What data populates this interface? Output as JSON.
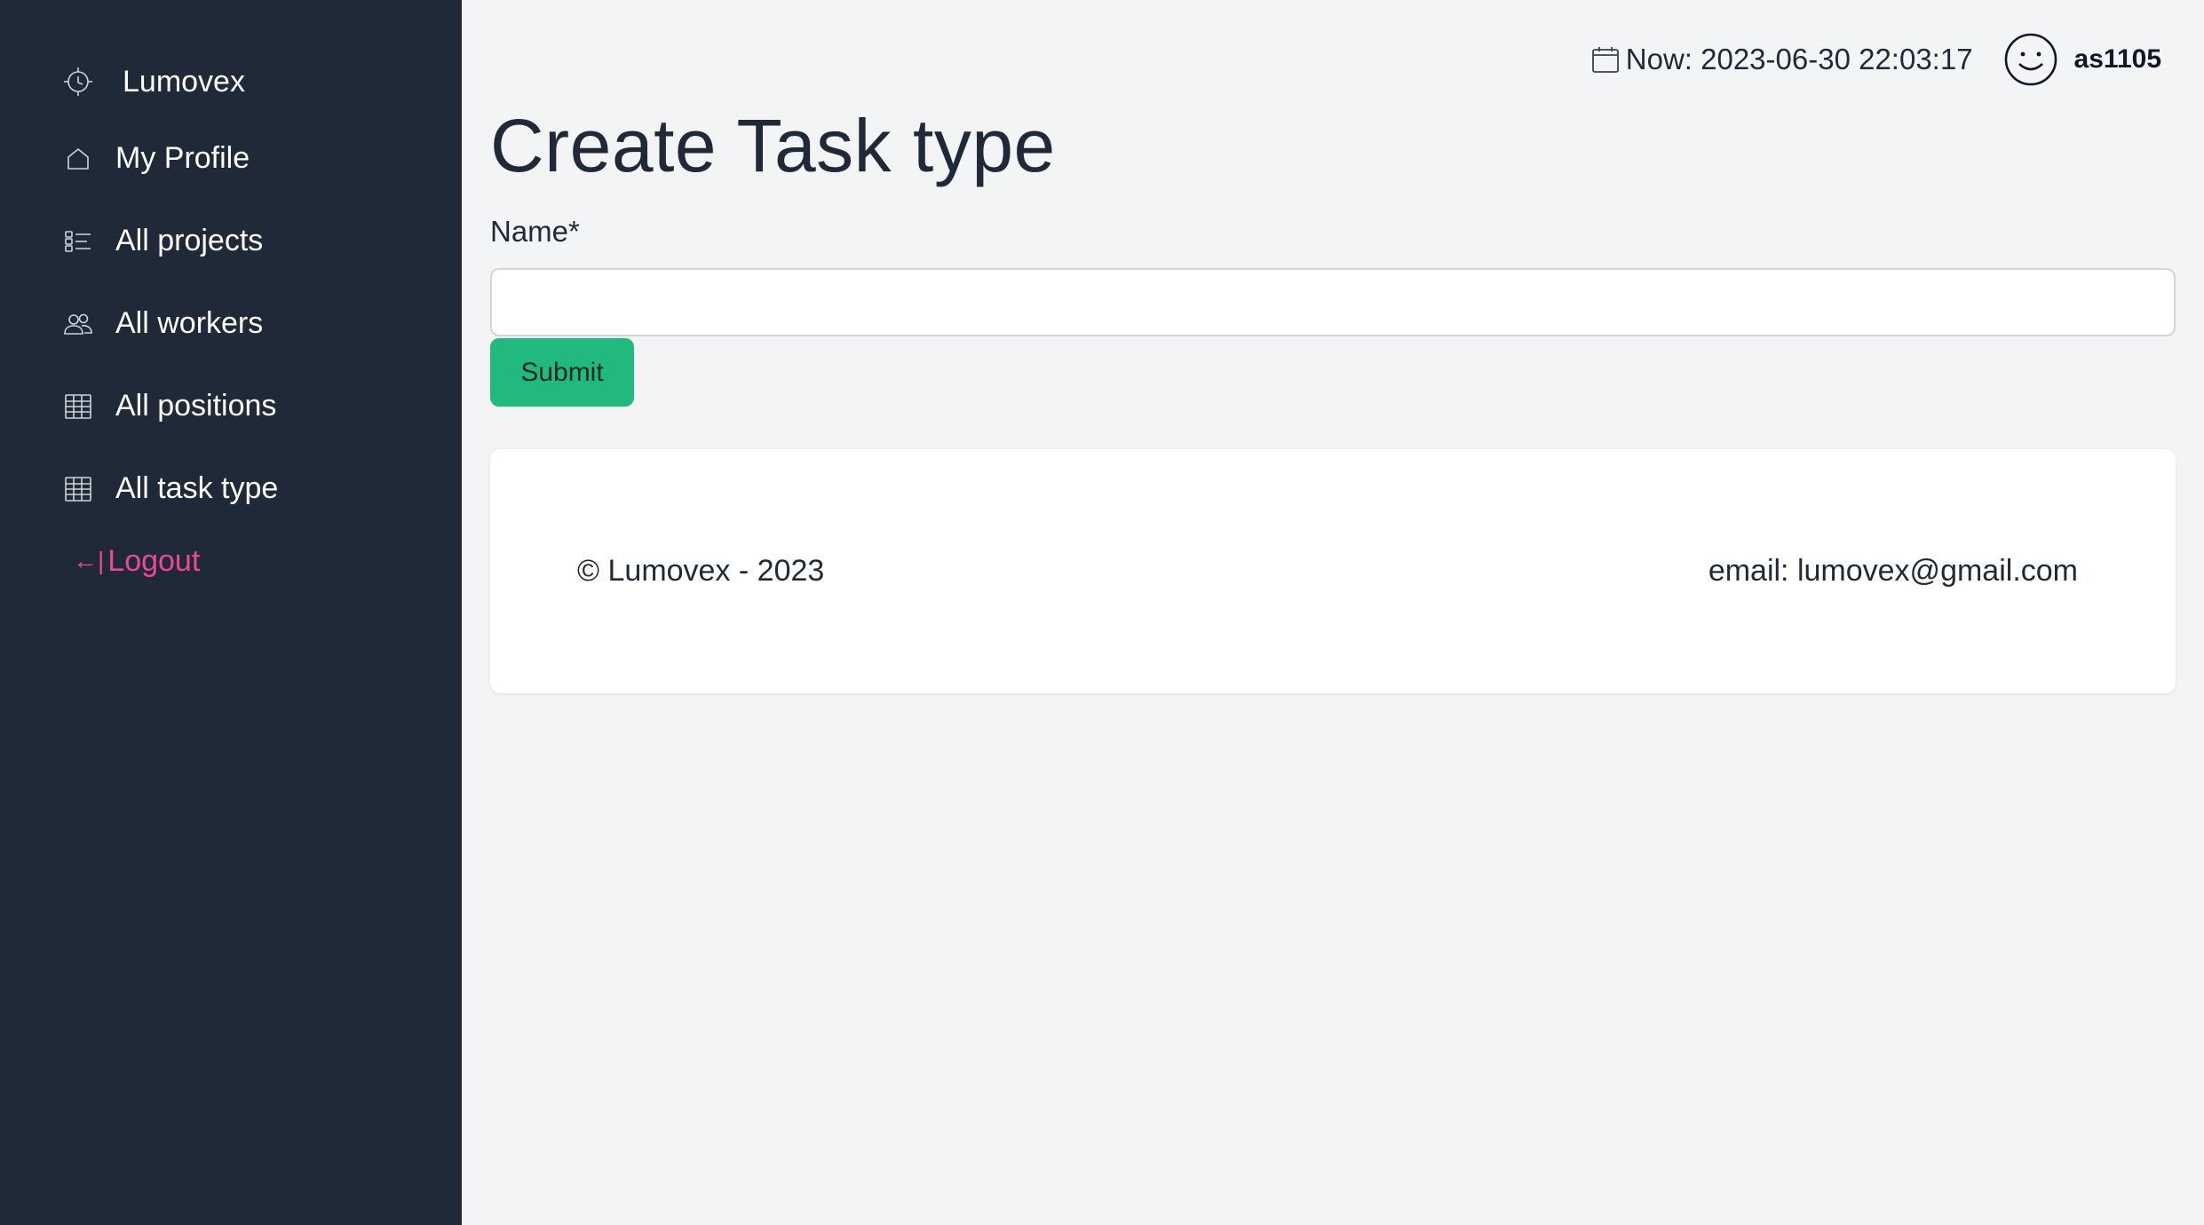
{
  "sidebar": {
    "brand": "Lumovex",
    "items": [
      {
        "label": "My Profile",
        "icon": "home-icon"
      },
      {
        "label": "All projects",
        "icon": "checklist-icon"
      },
      {
        "label": "All workers",
        "icon": "users-icon"
      },
      {
        "label": "All positions",
        "icon": "table-icon"
      },
      {
        "label": "All task type",
        "icon": "table-icon"
      }
    ],
    "logout": "Logout",
    "logout_arrow": "←|"
  },
  "header": {
    "now": "Now: 2023-06-30 22:03:17",
    "username": "as1105"
  },
  "page": {
    "title": "Create Task type",
    "name_label": "Name*",
    "name_value": "",
    "submit_label": "Submit"
  },
  "footer": {
    "copyright": "© Lumovex - 2023",
    "email": "email: lumovex@gmail.com"
  },
  "colors": {
    "sidebar_bg": "#1f2937",
    "page_bg": "#f3f4f6",
    "accent_green": "#22b97e",
    "logout_pink": "#ec4899"
  }
}
